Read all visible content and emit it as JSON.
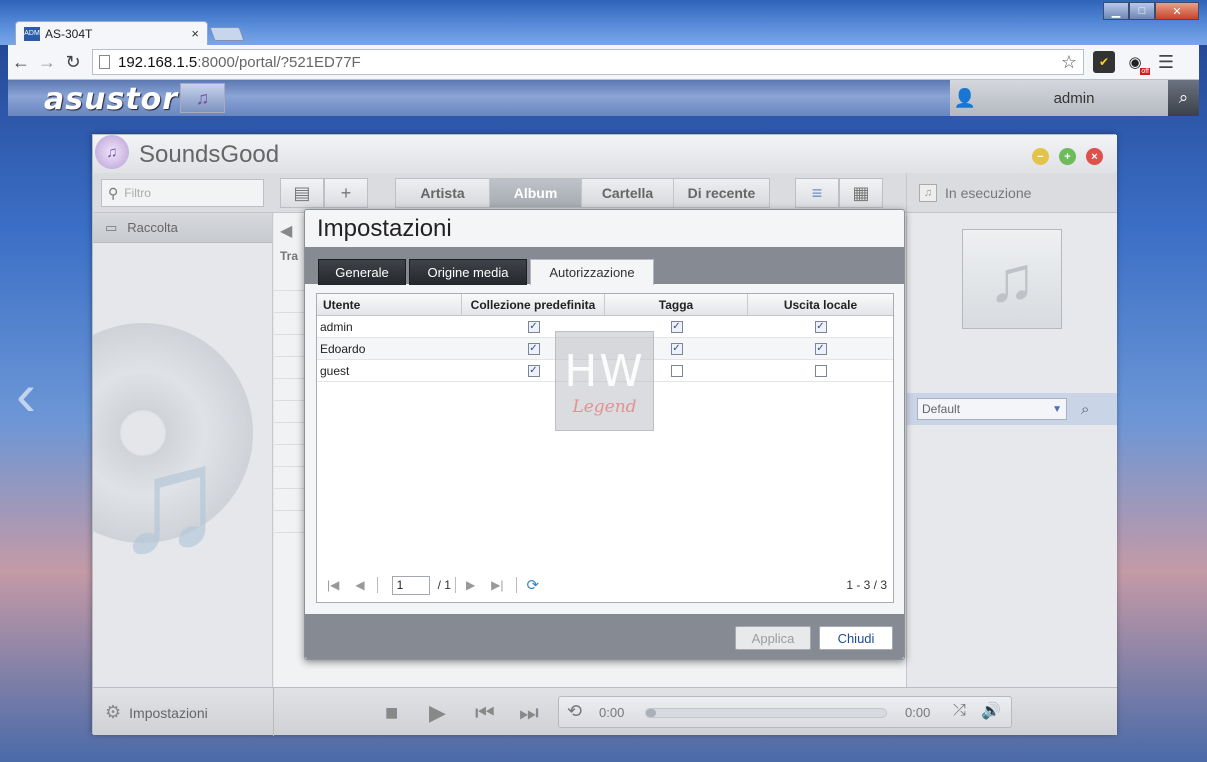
{
  "browser": {
    "tab_title": "AS-304T",
    "tab_close": "×",
    "url_host": "192.168.1.5",
    "url_rest": ":8000/portal/?521ED77F",
    "favicon_text": "ADM",
    "ext_badge": "off",
    "icons": [
      "back-arrow-icon",
      "forward-arrow-icon",
      "reload-icon",
      "bookmark-star-icon",
      "norton-icon",
      "extension-off-icon",
      "menu-icon"
    ]
  },
  "adm": {
    "logo": "asustor",
    "user": "admin"
  },
  "app": {
    "title": "SoundsGood",
    "filter_placeholder": "Filtro",
    "view_tabs": [
      "Artista",
      "Album",
      "Cartella",
      "Di recente"
    ],
    "active_view_tab": "Album",
    "sidebar_collection": "Raccolta",
    "list_header_cut": "Tra",
    "now_playing": "In esecuzione",
    "playlist_selected": "Default",
    "footer_settings": "Impostazioni",
    "player": {
      "time_elapsed": "0:00",
      "time_total": "0:00",
      "progress": 0
    }
  },
  "dialog": {
    "title": "Impostazioni",
    "tabs": [
      "Generale",
      "Origine media",
      "Autorizzazione"
    ],
    "active_tab": "Autorizzazione",
    "columns": [
      "Utente",
      "Collezione predefinita",
      "Tagga",
      "Uscita locale"
    ],
    "rows": [
      {
        "user": "admin",
        "default_collection": true,
        "tag": true,
        "local_output": true
      },
      {
        "user": "Edoardo",
        "default_collection": true,
        "tag": true,
        "local_output": true
      },
      {
        "user": "guest",
        "default_collection": true,
        "tag": false,
        "local_output": false
      }
    ],
    "watermark_main": "HW",
    "watermark_sub": "Legend",
    "pager": {
      "page": "1",
      "total_pages": "/ 1",
      "range": "1 - 3 / 3"
    },
    "apply_label": "Applica",
    "close_label": "Chiudi"
  }
}
